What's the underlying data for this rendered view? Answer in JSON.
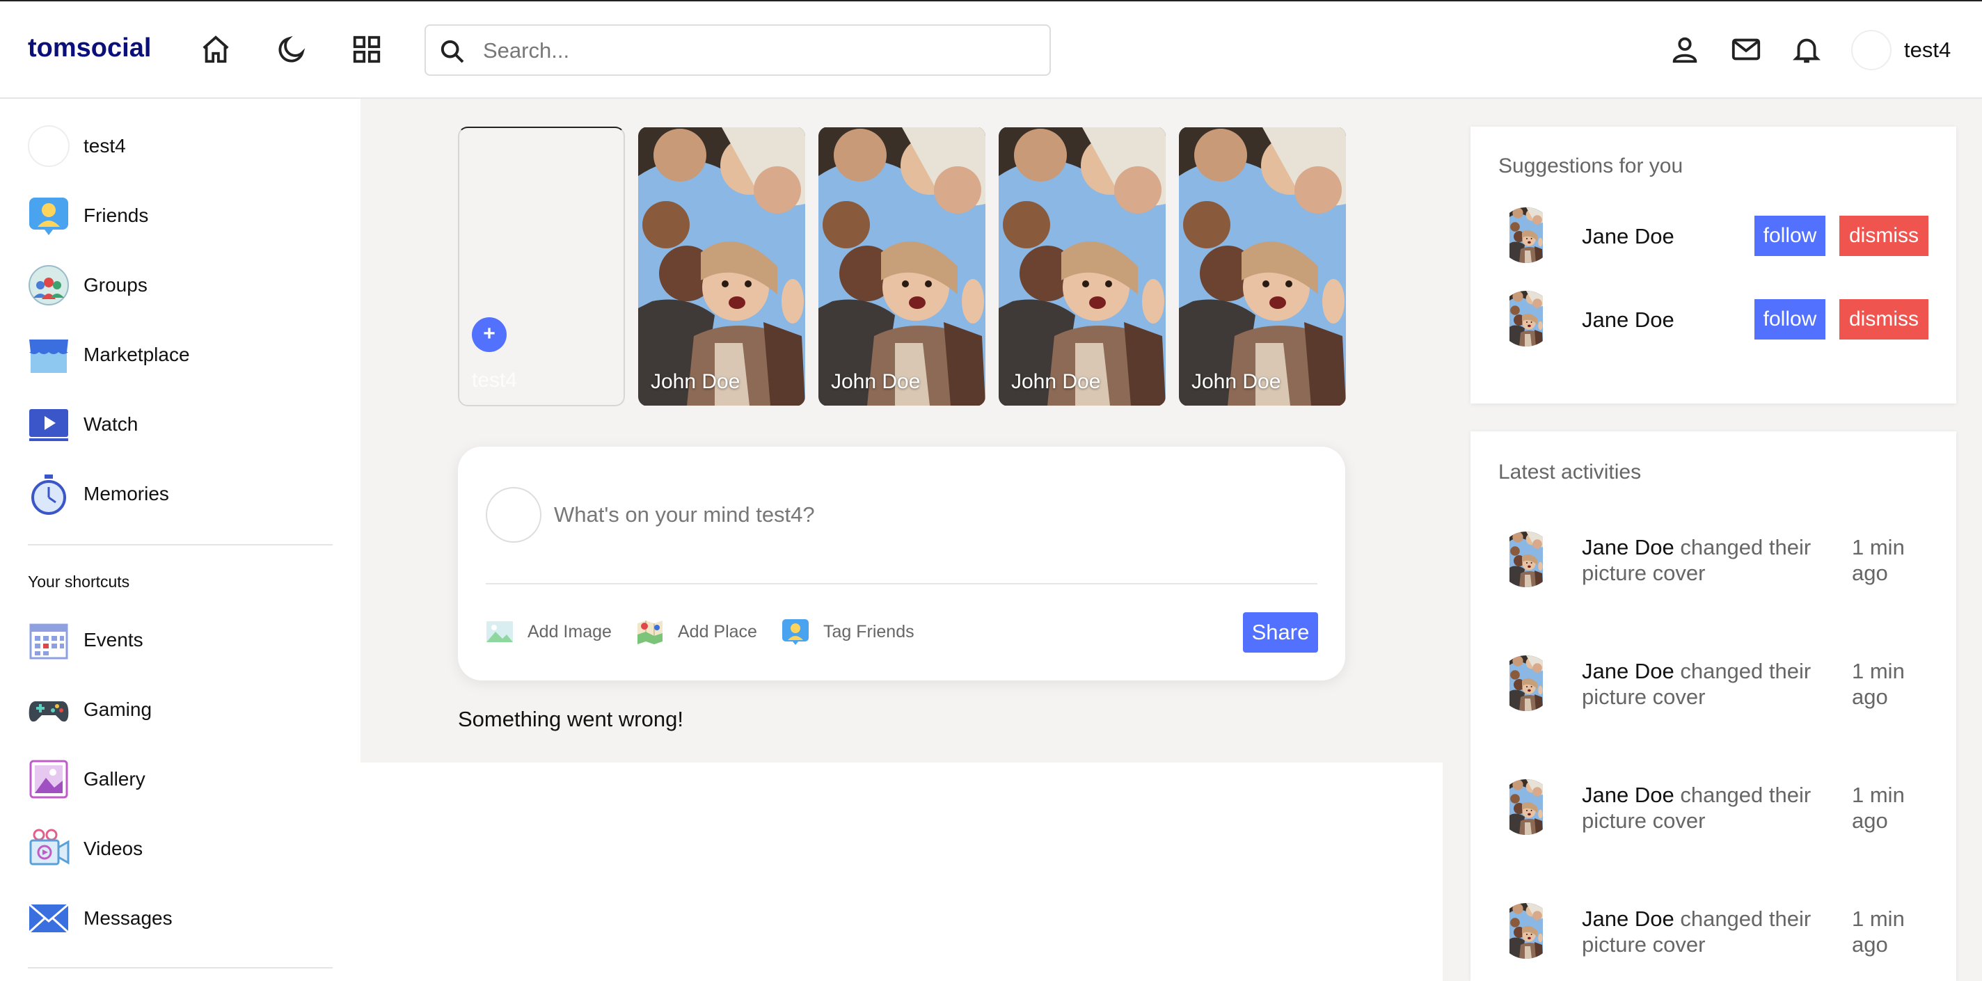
{
  "app": {
    "logo": "tomsocial"
  },
  "navbar": {
    "search_placeholder": "Search...",
    "username": "test4",
    "icons": [
      "home-icon",
      "moon-icon",
      "grid-icon",
      "search-icon",
      "person-icon",
      "mail-icon",
      "bell-icon"
    ]
  },
  "sidebar": {
    "user": "test4",
    "items": [
      {
        "label": "Friends",
        "icon": "friends-icon"
      },
      {
        "label": "Groups",
        "icon": "groups-icon"
      },
      {
        "label": "Marketplace",
        "icon": "marketplace-icon"
      },
      {
        "label": "Watch",
        "icon": "watch-icon"
      },
      {
        "label": "Memories",
        "icon": "memories-icon"
      }
    ],
    "shortcuts_title": "Your shortcuts",
    "shortcuts": [
      {
        "label": "Events",
        "icon": "events-icon"
      },
      {
        "label": "Gaming",
        "icon": "gaming-icon"
      },
      {
        "label": "Gallery",
        "icon": "gallery-icon"
      },
      {
        "label": "Videos",
        "icon": "videos-icon"
      },
      {
        "label": "Messages",
        "icon": "messages-icon"
      }
    ]
  },
  "stories": {
    "own": "test4",
    "add_symbol": "+",
    "items": [
      {
        "name": "John Doe"
      },
      {
        "name": "John Doe"
      },
      {
        "name": "John Doe"
      },
      {
        "name": "John Doe"
      }
    ]
  },
  "composer": {
    "placeholder": "What's on your mind test4?",
    "actions": [
      {
        "label": "Add Image",
        "icon": "image-icon"
      },
      {
        "label": "Add Place",
        "icon": "map-icon"
      },
      {
        "label": "Tag Friends",
        "icon": "tag-friends-icon"
      }
    ],
    "share": "Share"
  },
  "feed": {
    "error": "Something went wrong!"
  },
  "suggestions": {
    "title": "Suggestions for you",
    "follow": "follow",
    "dismiss": "dismiss",
    "items": [
      {
        "name": "Jane Doe"
      },
      {
        "name": "Jane Doe"
      }
    ]
  },
  "activities": {
    "title": "Latest activities",
    "items": [
      {
        "name": "Jane Doe",
        "text": " changed their picture cover",
        "time": "1 min ago"
      },
      {
        "name": "Jane Doe",
        "text": " changed their picture cover",
        "time": "1 min ago"
      },
      {
        "name": "Jane Doe",
        "text": " changed their picture cover",
        "time": "1 min ago"
      },
      {
        "name": "Jane Doe",
        "text": " changed their picture cover",
        "time": "1 min ago"
      }
    ]
  },
  "colors": {
    "accent": "#5271ff",
    "danger": "#f0544f",
    "logo": "#0b0f7a",
    "page_bg": "#f4f3f2"
  }
}
